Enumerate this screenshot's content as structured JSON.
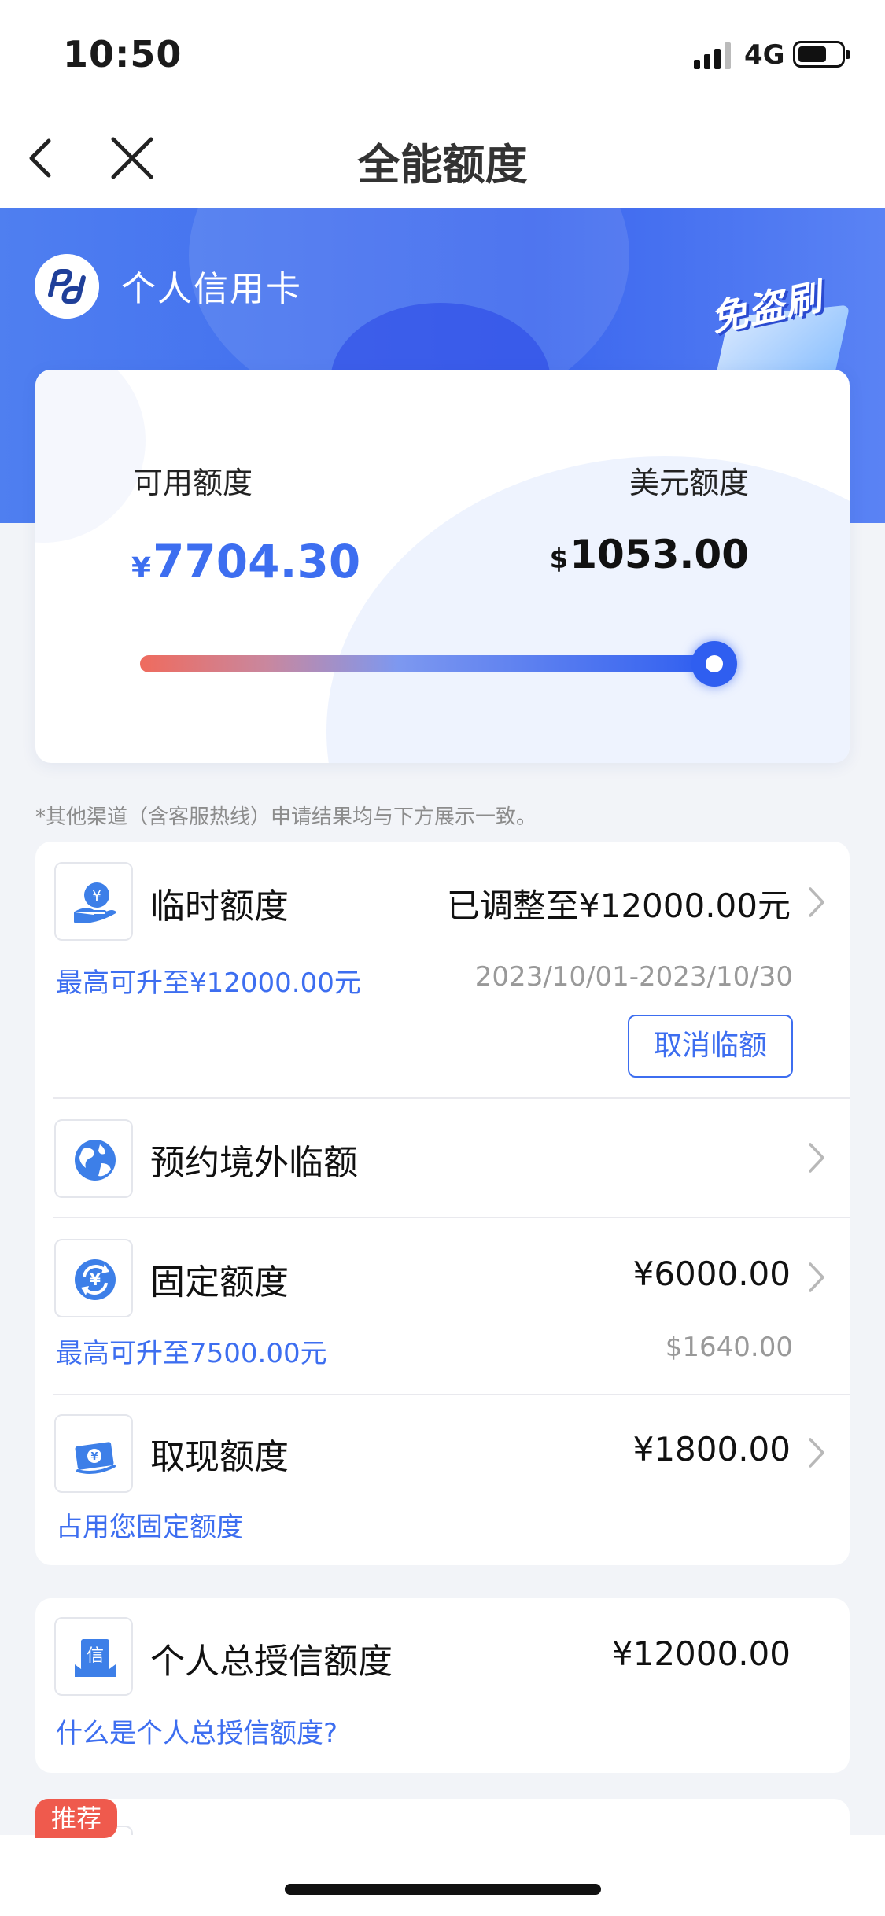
{
  "status_bar": {
    "time": "10:50",
    "network": "4G",
    "battery_level": 0.65
  },
  "nav": {
    "title": "全能额度"
  },
  "card": {
    "name": "个人信用卡",
    "badge": "免盗刷"
  },
  "quota": {
    "available_label": "可用额度",
    "available_currency": "¥",
    "available_amount": "7704.30",
    "usd_label": "美元额度",
    "usd_currency": "$",
    "usd_amount": "1053.00",
    "slider_fraction": 0.96
  },
  "notice": "*其他渠道（含客服热线）申请结果均与下方展示一致。",
  "items": {
    "temp": {
      "title": "临时额度",
      "value": "已调整至¥12000.00元",
      "sub_left": "最高可升至¥12000.00元",
      "sub_right": "2023/10/01-2023/10/30",
      "button": "取消临额",
      "icon": "hand-yuan-icon"
    },
    "overseas": {
      "title": "预约境外临额",
      "icon": "globe-icon"
    },
    "fixed": {
      "title": "固定额度",
      "value": "¥6000.00",
      "sub_left": "最高可升至7500.00元",
      "sub_right": "$1640.00",
      "icon": "cycle-yuan-icon"
    },
    "cash": {
      "title": "取现额度",
      "value": "¥1800.00",
      "sub_left": "占用您固定额度",
      "icon": "cash-note-icon"
    }
  },
  "total": {
    "title": "个人总授信额度",
    "value": "¥12000.00",
    "link": "什么是个人总授信额度?",
    "icon": "credit-doc-icon"
  },
  "recommend_tag": "推荐",
  "colors": {
    "accent": "#3d6ef0",
    "hero": "#4b78f0",
    "tag": "#ef5a4d"
  }
}
